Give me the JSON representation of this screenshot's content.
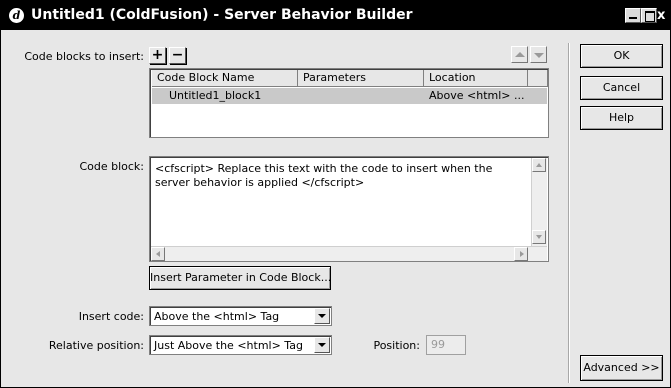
{
  "window": {
    "title": "Untitled1 (ColdFusion) - Server Behavior Builder",
    "close_glyph": "x"
  },
  "code_blocks": {
    "label": "Code blocks to insert:",
    "add_glyph": "+",
    "remove_glyph": "−",
    "columns": [
      "Code Block Name",
      "Parameters",
      "Location"
    ],
    "rows": [
      {
        "name": "Untitled1_block1",
        "parameters": "",
        "location": "Above <html> ..."
      }
    ]
  },
  "code_block": {
    "label": "Code block:",
    "value": "<cfscript> Replace this text with the code to insert when the server behavior is applied </cfscript>"
  },
  "insert_param_button": "Insert Parameter in Code Block...",
  "insert_code": {
    "label": "Insert code:",
    "value": "Above the <html> Tag"
  },
  "relative_position": {
    "label": "Relative position:",
    "value": "Just Above the <html> Tag"
  },
  "position": {
    "label": "Position:",
    "value": "99"
  },
  "buttons": {
    "ok": "OK",
    "cancel": "Cancel",
    "help": "Help",
    "advanced": "Advanced >>"
  }
}
